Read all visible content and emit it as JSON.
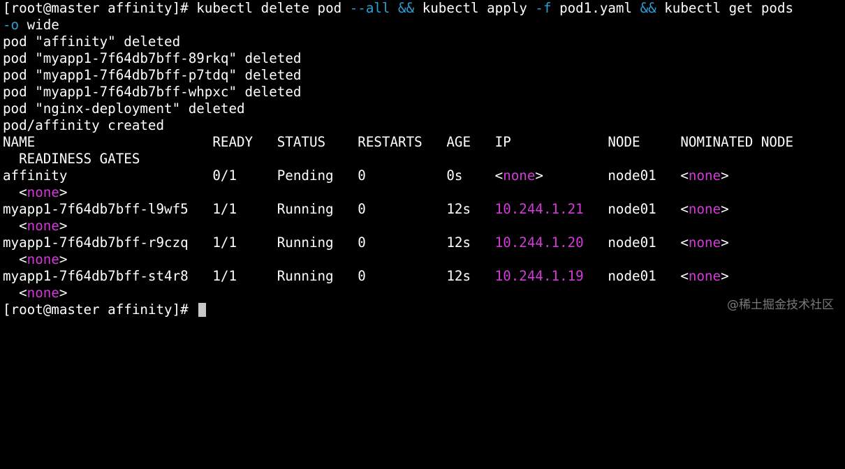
{
  "prompt": "[root@master affinity]# ",
  "command": {
    "part1": "kubectl delete pod ",
    "flag_all": "--all",
    "and1": "&&",
    "part2": " kubectl apply ",
    "flag_f": "-f",
    "part3": " pod1.yaml ",
    "and2": "&&",
    "part4": " kubectl get pods",
    "flag_o": "-o",
    "part5": " wide"
  },
  "deleted": [
    "pod \"affinity\" deleted",
    "pod \"myapp1-7f64db7bff-89rkq\" deleted",
    "pod \"myapp1-7f64db7bff-p7tdq\" deleted",
    "pod \"myapp1-7f64db7bff-whpxc\" deleted",
    "pod \"nginx-deployment\" deleted"
  ],
  "created": "pod/affinity created",
  "headers": {
    "name": "NAME",
    "ready": "READY",
    "status": "STATUS",
    "restarts": "RESTARTS",
    "age": "AGE",
    "ip": "IP",
    "node": "NODE",
    "nominated": "NOMINATED NODE",
    "readiness": "READINESS GATES"
  },
  "rows": [
    {
      "name": "affinity",
      "ready": "0/1",
      "status": "Pending",
      "restarts": "0",
      "age": "0s",
      "ip_open": "<",
      "ip": "none",
      "ip_close": ">",
      "node": "node01",
      "nom_open": "<",
      "nom": "none",
      "nom_close": ">",
      "rg_open": "<",
      "rg": "none",
      "rg_close": ">"
    },
    {
      "name": "myapp1-7f64db7bff-l9wf5",
      "ready": "1/1",
      "status": "Running",
      "restarts": "0",
      "age": "12s",
      "ip_open": "",
      "ip": "10.244.1.21",
      "ip_close": "",
      "node": "node01",
      "nom_open": "<",
      "nom": "none",
      "nom_close": ">",
      "rg_open": "<",
      "rg": "none",
      "rg_close": ">"
    },
    {
      "name": "myapp1-7f64db7bff-r9czq",
      "ready": "1/1",
      "status": "Running",
      "restarts": "0",
      "age": "12s",
      "ip_open": "",
      "ip": "10.244.1.20",
      "ip_close": "",
      "node": "node01",
      "nom_open": "<",
      "nom": "none",
      "nom_close": ">",
      "rg_open": "<",
      "rg": "none",
      "rg_close": ">"
    },
    {
      "name": "myapp1-7f64db7bff-st4r8",
      "ready": "1/1",
      "status": "Running",
      "restarts": "0",
      "age": "12s",
      "ip_open": "",
      "ip": "10.244.1.19",
      "ip_close": "",
      "node": "node01",
      "nom_open": "<",
      "nom": "none",
      "nom_close": ">",
      "rg_open": "<",
      "rg": "none",
      "rg_close": ">"
    }
  ],
  "final_prompt": "[root@master affinity]# ",
  "watermark": "@稀土掘金技术社区",
  "colors": {
    "background": "#000000",
    "text": "#ffffff",
    "operator": "#2b9fd6",
    "highlight": "#d43ad8",
    "cursor": "#c8c8c8"
  }
}
